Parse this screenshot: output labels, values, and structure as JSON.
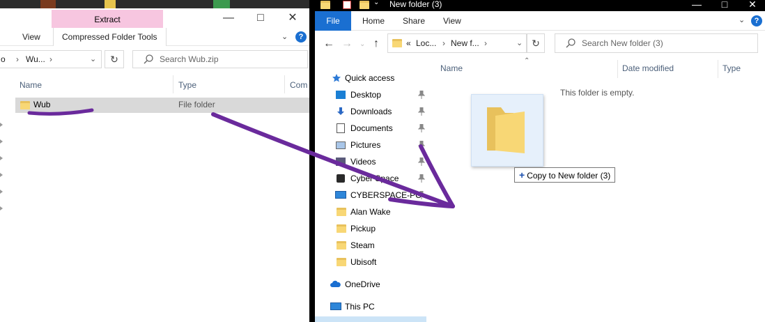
{
  "left_window": {
    "ribbon_tab_extract": "Extract",
    "ribbon_tab_view": "View",
    "ribbon_tab_tools": "Compressed Folder Tools",
    "help": "?",
    "breadcrumb_part1": "o",
    "breadcrumb_part2": "Wu...",
    "search_placeholder": "Search Wub.zip",
    "columns": [
      "Name",
      "Type",
      "Com"
    ],
    "rows": [
      {
        "name": "Wub",
        "type": "File folder"
      }
    ]
  },
  "right_window": {
    "title": "New folder (3)",
    "ribbon_tabs": [
      "File",
      "Home",
      "Share",
      "View"
    ],
    "help": "?",
    "breadcrumb": [
      "«",
      "Loc...",
      "New f..."
    ],
    "search_placeholder": "Search New folder (3)",
    "columns": [
      "Name",
      "Date modified",
      "Type"
    ],
    "nav": [
      {
        "label": "Quick access",
        "icon": "star-icon"
      },
      {
        "label": "Desktop",
        "icon": "desktop-icon",
        "pinned": true
      },
      {
        "label": "Downloads",
        "icon": "download-icon",
        "pinned": true
      },
      {
        "label": "Documents",
        "icon": "documents-icon",
        "pinned": true
      },
      {
        "label": "Pictures",
        "icon": "pictures-icon",
        "pinned": true
      },
      {
        "label": "Videos",
        "icon": "videos-icon",
        "pinned": true
      },
      {
        "label": "Cyber Space",
        "icon": "app-icon",
        "pinned": true
      },
      {
        "label": "CYBERSPACE-PC",
        "icon": "computer-icon",
        "pinned": true
      },
      {
        "label": "Alan Wake",
        "icon": "folder-icon"
      },
      {
        "label": "Pickup",
        "icon": "folder-icon"
      },
      {
        "label": "Steam",
        "icon": "folder-icon"
      },
      {
        "label": "Ubisoft",
        "icon": "folder-icon"
      },
      {
        "label": "OneDrive",
        "icon": "cloud-icon"
      },
      {
        "label": "This PC",
        "icon": "pc-icon"
      }
    ],
    "empty_message": "This folder is empty.",
    "drag_tooltip": "Copy to New folder (3)",
    "drag_tooltip_symbol": "+"
  },
  "colors": {
    "accent": "#1a6fd1",
    "extract_tab": "#f7c6e0",
    "annotation": "#6a2a9c"
  }
}
